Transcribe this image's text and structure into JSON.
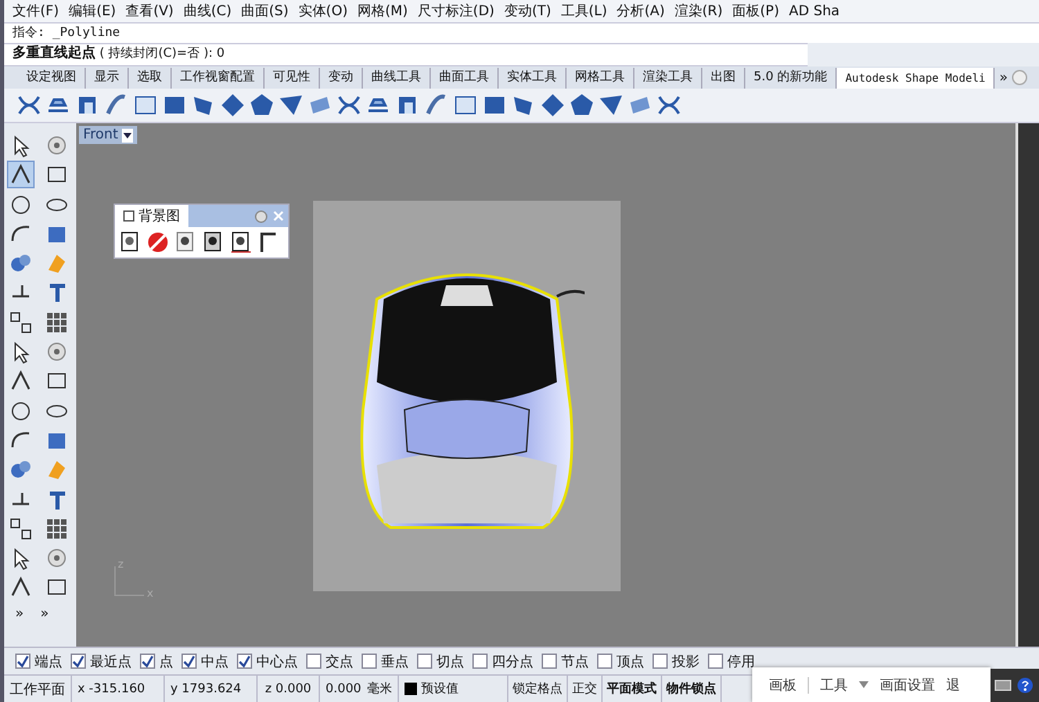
{
  "menu": [
    "文件(F)",
    "编辑(E)",
    "查看(V)",
    "曲线(C)",
    "曲面(S)",
    "实体(O)",
    "网格(M)",
    "尺寸标注(D)",
    "变动(T)",
    "工具(L)",
    "分析(A)",
    "渲染(R)",
    "面板(P)",
    "AD Sha"
  ],
  "command_history": "指令: _Polyline",
  "command_prompt": {
    "label": "多重直线起点",
    "options": "( 持续封闭(C)=否 ):",
    "value": "0"
  },
  "tabs": [
    {
      "label": "设定视图",
      "selected": false
    },
    {
      "label": "显示",
      "selected": false
    },
    {
      "label": "选取",
      "selected": false
    },
    {
      "label": "工作视窗配置",
      "selected": false
    },
    {
      "label": "可见性",
      "selected": false
    },
    {
      "label": "变动",
      "selected": false
    },
    {
      "label": "曲线工具",
      "selected": false
    },
    {
      "label": "曲面工具",
      "selected": false
    },
    {
      "label": "实体工具",
      "selected": false
    },
    {
      "label": "网格工具",
      "selected": false
    },
    {
      "label": "渲染工具",
      "selected": false
    },
    {
      "label": "出图",
      "selected": false
    },
    {
      "label": "5.0 的新功能",
      "selected": false
    },
    {
      "label": "Autodesk Shape Modeli",
      "selected": true
    }
  ],
  "tabs_more": "»",
  "side_tools": [
    {
      "selected": false
    },
    {
      "selected": false
    },
    {
      "selected": true
    },
    {
      "selected": false
    },
    {
      "selected": false
    },
    {
      "selected": false
    },
    {
      "selected": false
    },
    {
      "selected": false
    },
    {
      "selected": false
    },
    {
      "selected": false
    },
    {
      "selected": false
    },
    {
      "selected": false
    },
    {
      "selected": false
    },
    {
      "selected": false
    },
    {
      "selected": false
    },
    {
      "selected": false
    },
    {
      "selected": false
    },
    {
      "selected": false
    },
    {
      "selected": false
    },
    {
      "selected": false
    },
    {
      "selected": false
    },
    {
      "selected": false
    },
    {
      "selected": false
    },
    {
      "selected": false
    },
    {
      "selected": false
    },
    {
      "selected": false
    },
    {
      "selected": false
    },
    {
      "selected": false
    },
    {
      "selected": false
    },
    {
      "selected": false
    },
    {
      "selected": false
    },
    {
      "selected": false
    }
  ],
  "side_more": [
    "»",
    "»"
  ],
  "viewport": {
    "title": "Front",
    "axis_labels": [
      "z",
      "x"
    ]
  },
  "background_panel": {
    "title": "背景图"
  },
  "osnaps": [
    {
      "label": "端点",
      "checked": true
    },
    {
      "label": "最近点",
      "checked": true
    },
    {
      "label": "点",
      "checked": true
    },
    {
      "label": "中点",
      "checked": true
    },
    {
      "label": "中心点",
      "checked": true
    },
    {
      "label": "交点",
      "checked": false
    },
    {
      "label": "垂点",
      "checked": false
    },
    {
      "label": "切点",
      "checked": false
    },
    {
      "label": "四分点",
      "checked": false
    },
    {
      "label": "节点",
      "checked": false
    },
    {
      "label": "顶点",
      "checked": false
    },
    {
      "label": "投影",
      "checked": false
    },
    {
      "label": "停用",
      "checked": false
    }
  ],
  "status_bar": {
    "cplane": "工作平面",
    "x": "x -315.160",
    "y": "y 1793.624",
    "z": "z 0.000",
    "distance": "0.000",
    "units": "毫米",
    "layer": "预设值",
    "toggles": [
      {
        "label": "锁定格点",
        "on": false
      },
      {
        "label": "正交",
        "on": false
      },
      {
        "label": "平面模式",
        "on": true
      },
      {
        "label": "物件锁点",
        "on": true
      }
    ]
  },
  "overlay_bar": {
    "items": [
      "画板",
      "工具",
      "画面设置",
      "退"
    ]
  }
}
